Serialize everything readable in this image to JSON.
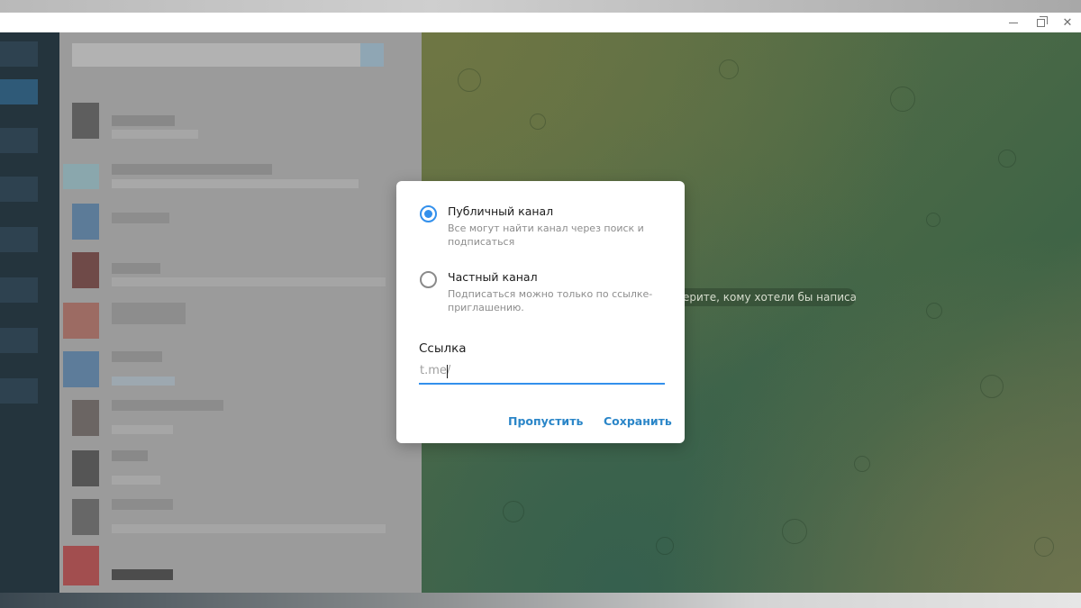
{
  "dialog": {
    "public_option": {
      "title": "Публичный канал",
      "description": "Все могут найти канал через поиск и подписаться",
      "selected": true
    },
    "private_option": {
      "title": "Частный канал",
      "description": "Подписаться можно только по ссылке-приглашению.",
      "selected": false
    },
    "link_label": "Ссылка",
    "link_prefix": "t.me/",
    "link_value": "",
    "skip_label": "Пропустить",
    "save_label": "Сохранить"
  },
  "chat_area": {
    "hint_text": "ерите, кому хотели бы написать"
  },
  "window_controls": {
    "minimize_icon": "minimize-icon",
    "restore_icon": "restore-icon",
    "close_icon": "close-icon"
  },
  "colors": {
    "accent": "#3390ec",
    "button_text": "#2b86c8"
  }
}
